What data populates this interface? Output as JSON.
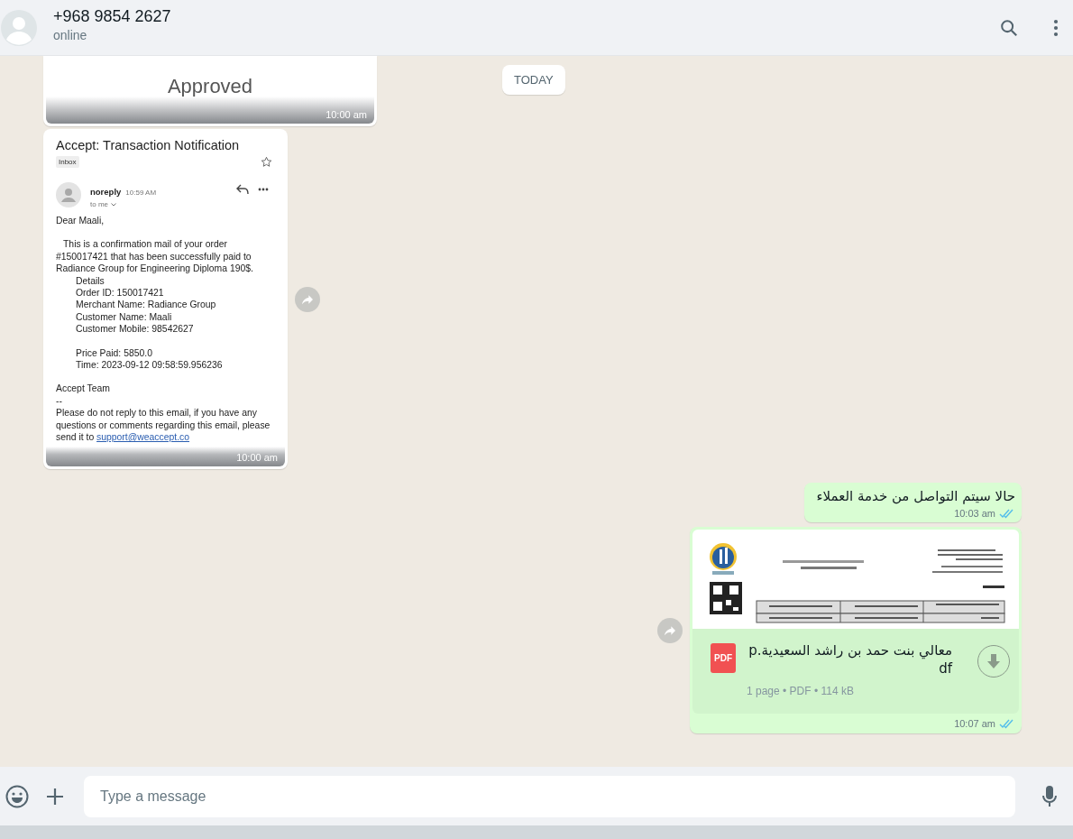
{
  "header": {
    "name": "+968 9854 2627",
    "status": "online"
  },
  "date_chip": "TODAY",
  "messages": [
    {
      "kind": "approved_image",
      "outgoing": false,
      "text": "Approved",
      "time": "10:00 am",
      "forward_button": false
    },
    {
      "kind": "email_image",
      "outgoing": false,
      "time": "10:00 am",
      "forward_button": true,
      "email": {
        "subject": "Accept: Transaction Notification",
        "label": "Inbox",
        "sender": "noreply",
        "sent": "10:59 AM",
        "recipient": "to me",
        "greeting": "Dear Maali,",
        "intro": "This is a confirmation mail of your order #150017421 that has been successfully paid to Radiance Group for Engineering Diploma 190$.",
        "details": [
          [
            "Details",
            "Order ID: 150017421",
            "Merchant Name: Radiance Group",
            "Customer Name: Maali",
            "Customer Mobile: 98542627"
          ],
          [
            "Price Paid: 5850.0",
            "Time: 2023-09-12 09:58:59.956236"
          ]
        ],
        "signature": "Accept Team",
        "separator": "--",
        "footer": "Please do not reply to this email, if you have any questions or comments regarding this email, please send it to",
        "link": "support@weaccept.co"
      }
    },
    {
      "kind": "text",
      "outgoing": true,
      "text": "حالا سيتم التواصل من خدمة العملاء",
      "time": "10:03 am",
      "read": true,
      "forward_button": false
    },
    {
      "kind": "document",
      "outgoing": true,
      "filename": "معالي بنت حمد بن راشد السعيدية.pdf",
      "file_icon": "PDF",
      "meta": "1 page • PDF • 114 kB",
      "time": "10:07 am",
      "read": true,
      "forward_button": true
    }
  ],
  "composer": {
    "placeholder": "Type a message"
  }
}
